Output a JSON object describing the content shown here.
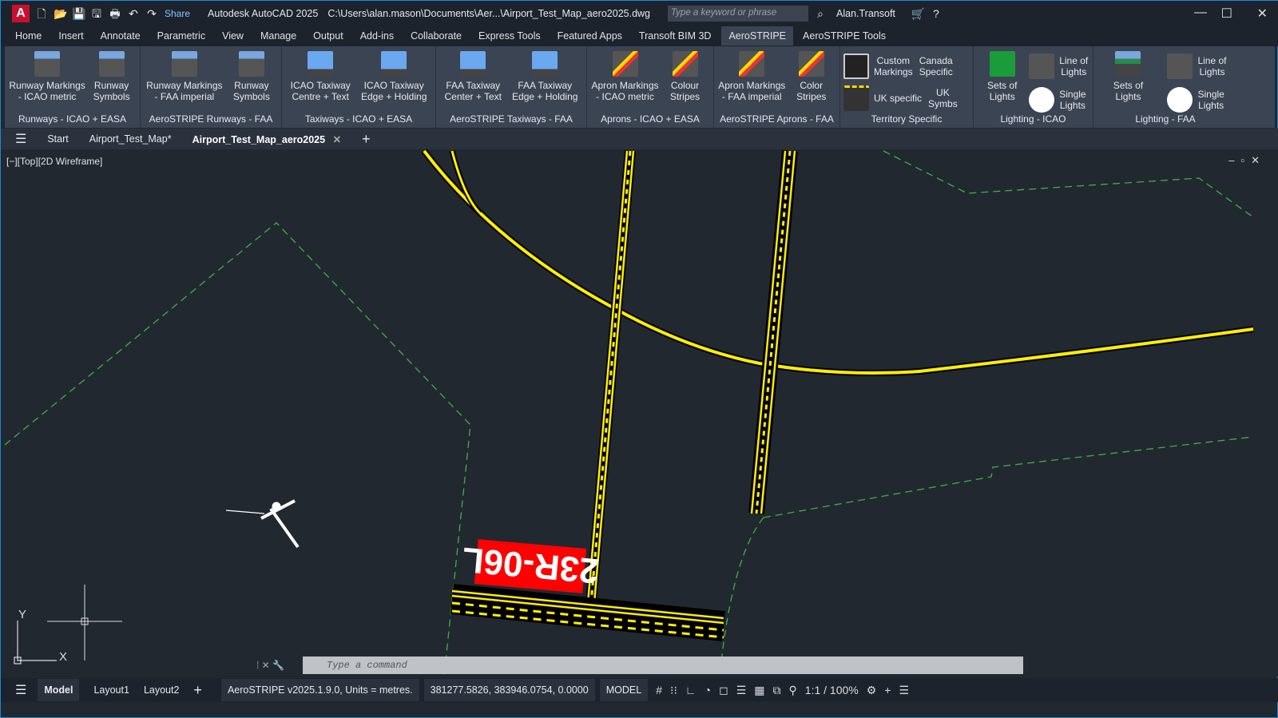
{
  "titlebar": {
    "share": "Share",
    "app": "Autodesk AutoCAD 2025",
    "path": "C:\\Users\\alan.mason\\Documents\\Aer...\\Airport_Test_Map_aero2025.dwg",
    "search_placeholder": "Type a keyword or phrase",
    "user": "Alan.Transoft"
  },
  "menu": [
    "Home",
    "Insert",
    "Annotate",
    "Parametric",
    "View",
    "Manage",
    "Output",
    "Add-ins",
    "Collaborate",
    "Express Tools",
    "Featured Apps",
    "Transoft BIM 3D",
    "AeroSTRIPE",
    "AeroSTRIPE Tools"
  ],
  "active_menu": "AeroSTRIPE",
  "ribbon": [
    {
      "title": "Runways - ICAO + EASA",
      "tools": [
        "Runway Markings\n- ICAO metric",
        "Runway\nSymbols"
      ],
      "icon": "runway-icon"
    },
    {
      "title": "AeroSTRIPE Runways - FAA",
      "tools": [
        "Runway Markings\n- FAA imperial",
        "Runway\nSymbols"
      ],
      "icon": "runway-icon"
    },
    {
      "title": "Taxiways - ICAO + EASA",
      "tools": [
        "ICAO Taxiway\nCentre + Text",
        "ICAO Taxiway\nEdge + Holding"
      ],
      "icon": "taxiway-icon"
    },
    {
      "title": "AeroSTRIPE Taxiways - FAA",
      "tools": [
        "FAA Taxiway\nCenter + Text",
        "FAA Taxiway\nEdge + Holding"
      ],
      "icon": "taxiway-icon"
    },
    {
      "title": "Aprons - ICAO + EASA",
      "tools": [
        "Apron Markings\n- ICAO metric",
        "Colour\nStripes"
      ],
      "icon": "apron-icon"
    },
    {
      "title": "AeroSTRIPE Aprons - FAA",
      "tools": [
        "Apron Markings\n- FAA imperial",
        "Color\nStripes"
      ],
      "icon": "apron-icon"
    }
  ],
  "territory": {
    "title": "Territory Specific",
    "items": [
      "Custom\nMarkings",
      "Canada\nSpecific",
      "UK specific",
      "UK\nSymbs"
    ]
  },
  "lighting_icao": {
    "title": "Lighting - ICAO",
    "items": [
      "Sets of\nLights",
      "Line of\nLights",
      "Single\nLights"
    ]
  },
  "lighting_faa": {
    "title": "Lighting - FAA",
    "items": [
      "Sets of\nLights",
      "Line of\nLights",
      "Single\nLights"
    ]
  },
  "doctabs": [
    "Start",
    "Airport_Test_Map*",
    "Airport_Test_Map_aero2025"
  ],
  "viewport": {
    "label": "[−][Top][2D Wireframe]",
    "runway_label": "23R-06L",
    "ucs_x": "X",
    "ucs_y": "Y"
  },
  "command": {
    "placeholder": "Type a command"
  },
  "status": {
    "layouts": [
      "Model",
      "Layout1",
      "Layout2"
    ],
    "version": "AeroSTRIPE v2025.1.9.0,  Units = metres.",
    "coords": "381277.5826, 383946.0754, 0.0000",
    "mode": "MODEL",
    "scale": "1:1 / 100%"
  },
  "colors": {
    "marking": "#ffee00",
    "boundary": "#3cb43c",
    "label_bg": "#ff0000",
    "viewport_bg": "#212830"
  }
}
